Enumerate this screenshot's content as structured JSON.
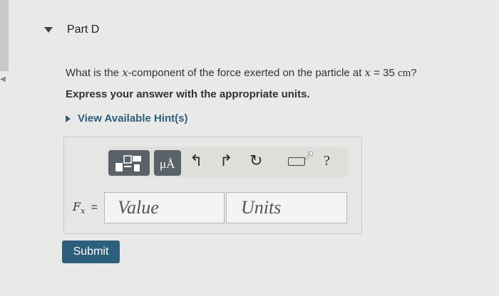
{
  "part": {
    "title": "Part D"
  },
  "question": {
    "prefix": "What is the ",
    "var": "x",
    "middle": "-component of the force exerted on the particle at ",
    "var2": "x",
    "equals": " = 35 ",
    "unit": "cm",
    "suffix": "?"
  },
  "instruction": "Express your answer with the appropriate units.",
  "hint": {
    "label": "View Available Hint(s)"
  },
  "answer": {
    "var_symbol": "F",
    "var_sub": "x",
    "equals": "=",
    "value_placeholder": "Value",
    "units_placeholder": "Units"
  },
  "toolbar": {
    "units_glyph": "μÅ",
    "undo_glyph": "↰",
    "redo_glyph": "↱",
    "reset_glyph": "↻",
    "help_glyph": "?"
  },
  "submit": {
    "label": "Submit"
  },
  "colors": {
    "accent": "#2c5f7c",
    "toolbar_button": "#5a6269"
  }
}
